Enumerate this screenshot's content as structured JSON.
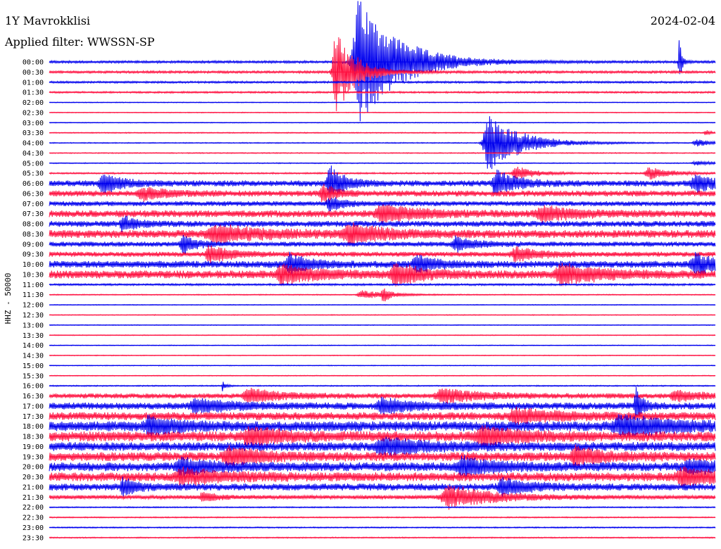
{
  "header": {
    "station": "1Y Mavrokklisi",
    "date": "2024-02-04",
    "filter": "Applied filter: WWSSN-SP"
  },
  "chart_data": {
    "type": "line",
    "ylabel": "HHZ - 50000",
    "colors": [
      "#0000ee",
      "#ff1040"
    ],
    "rows": [
      {
        "label": "00:00",
        "noise": 1.2,
        "events": [
          {
            "x": 0.465,
            "amp": 90,
            "w": 0.06
          },
          {
            "x": 0.945,
            "amp": 40,
            "w": 0.004
          }
        ]
      },
      {
        "label": "00:30",
        "noise": 1.2,
        "events": [
          {
            "x": 0.43,
            "amp": 60,
            "w": 0.03
          }
        ]
      },
      {
        "label": "01:00",
        "noise": 1.0,
        "events": []
      },
      {
        "label": "01:30",
        "noise": 0.9,
        "events": []
      },
      {
        "label": "02:00",
        "noise": 0.4,
        "events": []
      },
      {
        "label": "02:30",
        "noise": 0.4,
        "events": []
      },
      {
        "label": "03:00",
        "noise": 0.4,
        "events": []
      },
      {
        "label": "03:30",
        "noise": 0.5,
        "events": [
          {
            "x": 0.985,
            "amp": 4,
            "w": 0.01
          }
        ]
      },
      {
        "label": "04:00",
        "noise": 0.5,
        "events": [
          {
            "x": 0.66,
            "amp": 40,
            "w": 0.05
          },
          {
            "x": 0.97,
            "amp": 6,
            "w": 0.02
          }
        ]
      },
      {
        "label": "04:30",
        "noise": 0.5,
        "events": []
      },
      {
        "label": "05:00",
        "noise": 0.5,
        "events": [
          {
            "x": 0.97,
            "amp": 3,
            "w": 0.03
          }
        ]
      },
      {
        "label": "05:30",
        "noise": 0.8,
        "events": [
          {
            "x": 0.7,
            "amp": 10,
            "w": 0.03
          },
          {
            "x": 0.9,
            "amp": 10,
            "w": 0.03
          }
        ]
      },
      {
        "label": "06:00",
        "noise": 3.0,
        "events": [
          {
            "x": 0.08,
            "amp": 14,
            "w": 0.03
          },
          {
            "x": 0.42,
            "amp": 30,
            "w": 0.02
          },
          {
            "x": 0.67,
            "amp": 20,
            "w": 0.03
          },
          {
            "x": 0.97,
            "amp": 12,
            "w": 0.04
          }
        ]
      },
      {
        "label": "06:30",
        "noise": 3.0,
        "events": [
          {
            "x": 0.14,
            "amp": 8,
            "w": 0.04
          },
          {
            "x": 0.41,
            "amp": 14,
            "w": 0.02
          }
        ]
      },
      {
        "label": "07:00",
        "noise": 2.5,
        "events": [
          {
            "x": 0.42,
            "amp": 10,
            "w": 0.02
          }
        ]
      },
      {
        "label": "07:30",
        "noise": 3.5,
        "events": [
          {
            "x": 0.5,
            "amp": 12,
            "w": 0.06
          },
          {
            "x": 0.74,
            "amp": 10,
            "w": 0.05
          }
        ]
      },
      {
        "label": "08:00",
        "noise": 3.0,
        "events": [
          {
            "x": 0.11,
            "amp": 12,
            "w": 0.02
          }
        ]
      },
      {
        "label": "08:30",
        "noise": 4.0,
        "events": [
          {
            "x": 0.25,
            "amp": 12,
            "w": 0.07
          },
          {
            "x": 0.45,
            "amp": 14,
            "w": 0.05
          }
        ]
      },
      {
        "label": "09:00",
        "noise": 2.5,
        "events": [
          {
            "x": 0.2,
            "amp": 14,
            "w": 0.02
          },
          {
            "x": 0.61,
            "amp": 10,
            "w": 0.03
          }
        ]
      },
      {
        "label": "09:30",
        "noise": 2.5,
        "events": [
          {
            "x": 0.24,
            "amp": 14,
            "w": 0.03
          },
          {
            "x": 0.7,
            "amp": 10,
            "w": 0.04
          }
        ]
      },
      {
        "label": "10:00",
        "noise": 3.5,
        "events": [
          {
            "x": 0.36,
            "amp": 14,
            "w": 0.03
          },
          {
            "x": 0.55,
            "amp": 12,
            "w": 0.03
          },
          {
            "x": 0.97,
            "amp": 16,
            "w": 0.04
          }
        ]
      },
      {
        "label": "10:30",
        "noise": 4.0,
        "events": [
          {
            "x": 0.35,
            "amp": 14,
            "w": 0.05
          },
          {
            "x": 0.52,
            "amp": 16,
            "w": 0.04
          },
          {
            "x": 0.77,
            "amp": 14,
            "w": 0.06
          }
        ]
      },
      {
        "label": "11:00",
        "noise": 1.0,
        "events": []
      },
      {
        "label": "11:30",
        "noise": 0.5,
        "events": [
          {
            "x": 0.47,
            "amp": 6,
            "w": 0.04
          },
          {
            "x": 0.5,
            "amp": 12,
            "w": 0.01
          }
        ]
      },
      {
        "label": "12:00",
        "noise": 0.4,
        "events": []
      },
      {
        "label": "12:30",
        "noise": 0.4,
        "events": []
      },
      {
        "label": "13:00",
        "noise": 0.4,
        "events": []
      },
      {
        "label": "13:30",
        "noise": 0.4,
        "events": []
      },
      {
        "label": "14:00",
        "noise": 0.4,
        "events": []
      },
      {
        "label": "14:30",
        "noise": 0.4,
        "events": []
      },
      {
        "label": "15:00",
        "noise": 0.4,
        "events": []
      },
      {
        "label": "15:30",
        "noise": 0.4,
        "events": []
      },
      {
        "label": "16:00",
        "noise": 0.6,
        "events": [
          {
            "x": 0.26,
            "amp": 8,
            "w": 0.005
          }
        ]
      },
      {
        "label": "16:30",
        "noise": 2.5,
        "events": [
          {
            "x": 0.3,
            "amp": 10,
            "w": 0.05
          },
          {
            "x": 0.59,
            "amp": 10,
            "w": 0.06
          },
          {
            "x": 0.94,
            "amp": 8,
            "w": 0.04
          }
        ]
      },
      {
        "label": "17:00",
        "noise": 3.5,
        "events": [
          {
            "x": 0.22,
            "amp": 10,
            "w": 0.05
          },
          {
            "x": 0.5,
            "amp": 10,
            "w": 0.05
          },
          {
            "x": 0.88,
            "amp": 30,
            "w": 0.01
          }
        ]
      },
      {
        "label": "17:30",
        "noise": 4.0,
        "events": [
          {
            "x": 0.7,
            "amp": 10,
            "w": 0.06
          }
        ]
      },
      {
        "label": "18:00",
        "noise": 5.0,
        "events": [
          {
            "x": 0.15,
            "amp": 12,
            "w": 0.04
          },
          {
            "x": 0.86,
            "amp": 14,
            "w": 0.08
          }
        ]
      },
      {
        "label": "18:30",
        "noise": 5.0,
        "events": [
          {
            "x": 0.3,
            "amp": 12,
            "w": 0.05
          },
          {
            "x": 0.65,
            "amp": 14,
            "w": 0.05
          }
        ]
      },
      {
        "label": "19:00",
        "noise": 4.5,
        "events": [
          {
            "x": 0.5,
            "amp": 12,
            "w": 0.06
          }
        ]
      },
      {
        "label": "19:30",
        "noise": 4.5,
        "events": [
          {
            "x": 0.27,
            "amp": 12,
            "w": 0.05
          },
          {
            "x": 0.79,
            "amp": 14,
            "w": 0.04
          }
        ]
      },
      {
        "label": "20:00",
        "noise": 4.5,
        "events": [
          {
            "x": 0.2,
            "amp": 10,
            "w": 0.05
          },
          {
            "x": 0.62,
            "amp": 12,
            "w": 0.05
          },
          {
            "x": 0.96,
            "amp": 10,
            "w": 0.04
          }
        ]
      },
      {
        "label": "20:30",
        "noise": 4.5,
        "events": [
          {
            "x": 0.2,
            "amp": 10,
            "w": 0.06
          },
          {
            "x": 0.95,
            "amp": 12,
            "w": 0.05
          }
        ]
      },
      {
        "label": "21:00",
        "noise": 3.5,
        "events": [
          {
            "x": 0.11,
            "amp": 12,
            "w": 0.02
          },
          {
            "x": 0.68,
            "amp": 12,
            "w": 0.04
          }
        ]
      },
      {
        "label": "21:30",
        "noise": 2.0,
        "events": [
          {
            "x": 0.23,
            "amp": 8,
            "w": 0.02
          },
          {
            "x": 0.6,
            "amp": 16,
            "w": 0.07
          }
        ]
      },
      {
        "label": "22:00",
        "noise": 0.6,
        "events": []
      },
      {
        "label": "22:30",
        "noise": 0.6,
        "events": []
      },
      {
        "label": "23:00",
        "noise": 0.6,
        "events": []
      },
      {
        "label": "23:30",
        "noise": 0.6,
        "events": []
      }
    ]
  }
}
